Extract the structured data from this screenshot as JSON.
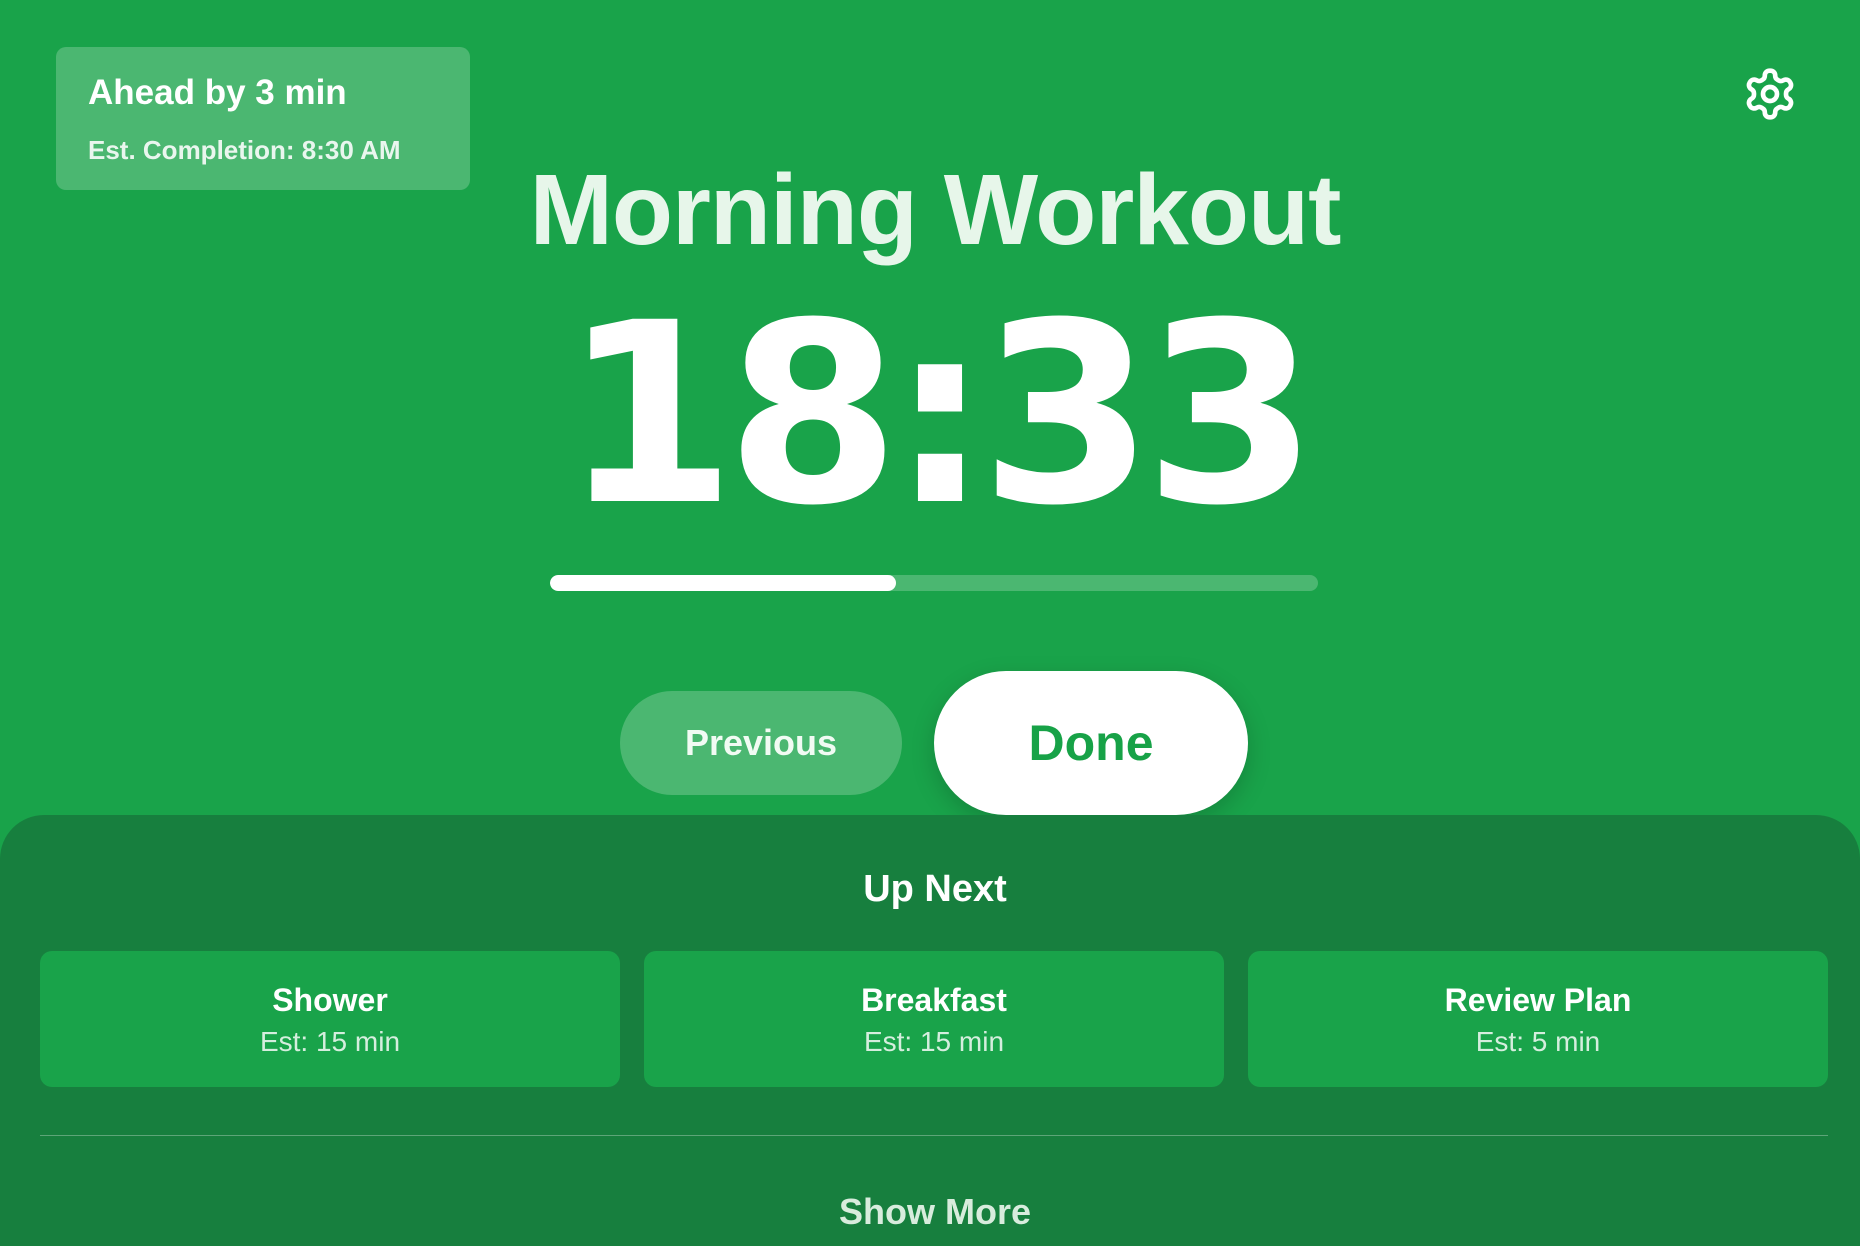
{
  "status": {
    "ahead_text": "Ahead by 3 min",
    "completion_text": "Est. Completion: 8:30 AM"
  },
  "settings": {
    "icon": "gear-icon"
  },
  "routine": {
    "title": "Morning Workout",
    "timer": "18:33",
    "progress": 0.45
  },
  "controls": {
    "previous_label": "Previous",
    "done_label": "Done"
  },
  "up_next": {
    "title": "Up Next",
    "items": [
      {
        "name": "Shower",
        "estimate": "Est: 15 min"
      },
      {
        "name": "Breakfast",
        "estimate": "Est: 15 min"
      },
      {
        "name": "Review Plan",
        "estimate": "Est: 5 min"
      }
    ],
    "show_more_label": "Show More"
  },
  "colors": {
    "background": "#19a34a",
    "panel": "#177f3e",
    "accent": "#17a247",
    "text": "#ffffff"
  }
}
